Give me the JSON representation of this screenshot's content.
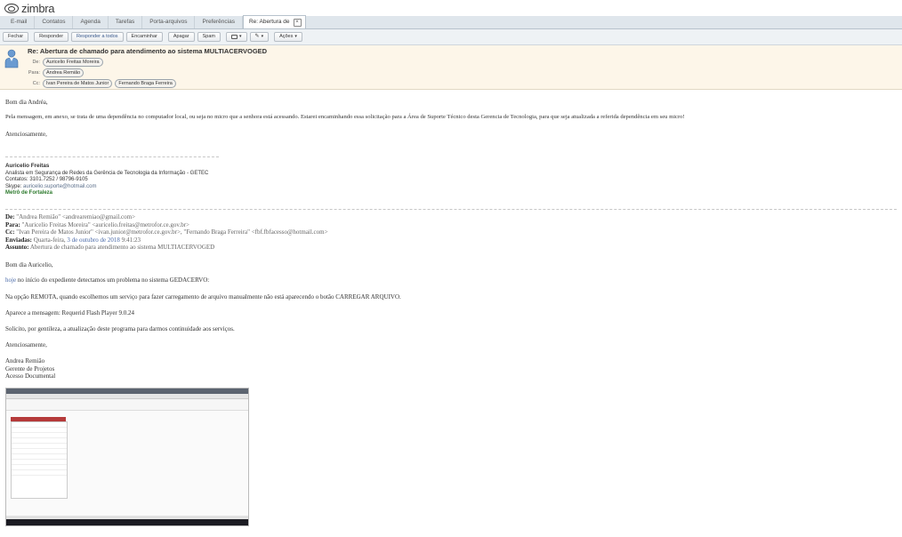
{
  "app": {
    "logo_text": "zimbra"
  },
  "tabs": [
    "E-mail",
    "Contatos",
    "Agenda",
    "Tarefas",
    "Porta-arquivos",
    "Preferências"
  ],
  "active_tab": {
    "label": "Re: Abertura de"
  },
  "toolbar": {
    "close": "Fechar",
    "reply": "Responder",
    "reply_all": "Responder a todos",
    "forward": "Encaminhar",
    "delete": "Apagar",
    "spam": "Spam",
    "actions": "Ações"
  },
  "message": {
    "subject": "Re: Abertura de chamado para atendimento ao sistema MULTIACERVOGED",
    "from_label": "De:",
    "from": "Auricelio Freitas Moreira",
    "to_label": "Para:",
    "to": "Andrea Remião",
    "cc_label": "Cc:",
    "cc": [
      "Ivan Pereira de Matos Junior",
      "Fernando Braga Ferreira"
    ]
  },
  "reply_body": {
    "greeting": "Bom dia Andréa,",
    "paragraph": "Pela mensagem, em anexo, se trata de uma dependência no computador local, ou seja no micro que a senhora está acessando. Estarei encaminhando essa solicitação para a Área de Suporte Técnico desta Gerencia de Tecnologia, para que seja atualizada a referida dependência em seu micro!",
    "closing": "Atenciosamente,"
  },
  "signature": {
    "name": "Auricelio Freitas",
    "role": "Analista em Segurança de Redes da Gerência de Tecnologia da Informação - GETEC",
    "contacts": "Contatos: 3101.7252 / 98796-9105",
    "skype_label": "Skype: ",
    "skype": "auricelio.suporte@hotmail.com",
    "company": "Metrô de Fortaleza"
  },
  "quoted": {
    "from_label": "De:",
    "from_name": "\"Andrea Remião\"",
    "from_email": "<andrearemiao@gmail.com>",
    "to_label": "Para:",
    "to_name": "\"Auricelio Freitas Moreira\"",
    "to_email": "<auricelio.freitas@metrofor.ce.gov.br>",
    "cc_label": "Cc:",
    "cc_name1": "\"Ivan Pereira de Matos Junior\"",
    "cc_email1": "<ivan.junior@metrofor.ce.gov.br>",
    "cc_name2": ", \"Fernando Braga Ferreira\"",
    "cc_email2": "<fbf.fbfacesso@hotmail.com>",
    "sent_label": "Enviadas:",
    "sent_day": "Quarta-feira,",
    "sent_date": "3 de outubro de 2018",
    "sent_time": "9:41:23",
    "subject_label": "Assunto:",
    "subject": "Abertura de chamado para atendimento ao sistema MULTIACERVOGED",
    "greeting": "Bom dia Auricelio,",
    "p1_link": "hoje",
    "p1": "no início do expediente detectamos um problema no sistema GEDACERVO:",
    "p2": "Na opção REMOTA, quando escolhemos um serviço para fazer carregamento de arquivo manualmente não está aparecendo o botão CARREGAR ARQUIVO.",
    "p3": "Aparece a mensagem: Requerid Flash Player 9.0.24",
    "p4": "Solicito, por gentileza, a atualização deste programa para darmos continuidade aos serviços.",
    "closing": "Atenciosamente,",
    "sig_name": "Andrea Remião",
    "sig_role": "Gerente de Projetos",
    "sig_dept": "Acesso Documental"
  },
  "colors": {
    "accent_green": "#2d7a2d",
    "header_bg": "#fdf6e9"
  }
}
